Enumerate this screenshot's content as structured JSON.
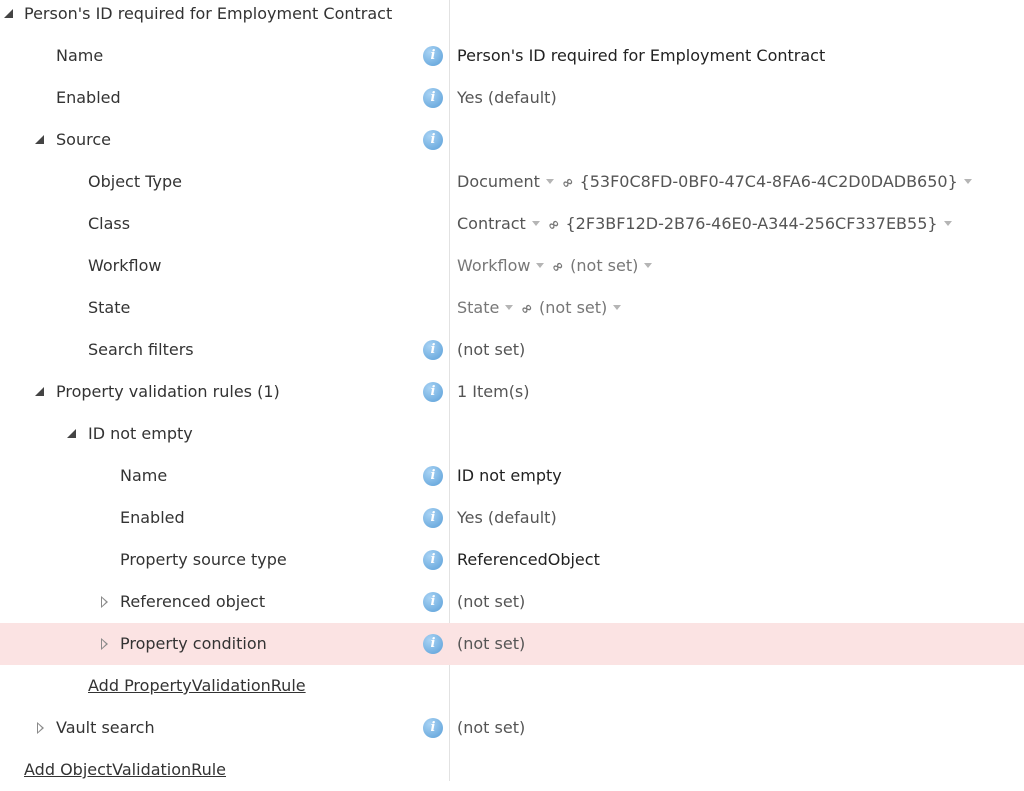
{
  "tree": {
    "root": {
      "label": "Person's ID required for Employment Contract"
    },
    "name": {
      "label": "Name",
      "value": "Person's ID required for Employment Contract"
    },
    "enabled": {
      "label": "Enabled",
      "value": "Yes (default)"
    },
    "source": {
      "label": "Source",
      "object_type": {
        "label": "Object Type",
        "value": "Document",
        "guid": "{53F0C8FD-0BF0-47C4-8FA6-4C2D0DADB650}"
      },
      "class": {
        "label": "Class",
        "value": "Contract",
        "guid": "{2F3BF12D-2B76-46E0-A344-256CF337EB55}"
      },
      "workflow": {
        "label": "Workflow",
        "value": "Workflow",
        "guid": "(not set)"
      },
      "state": {
        "label": "State",
        "value": "State",
        "guid": "(not set)"
      },
      "search_filters": {
        "label": "Search filters",
        "value": "(not set)"
      }
    },
    "pvr": {
      "label": "Property validation rules (1)",
      "value": "1 Item(s)",
      "rule": {
        "label": "ID not empty",
        "name": {
          "label": "Name",
          "value": "ID not empty"
        },
        "enabled": {
          "label": "Enabled",
          "value": "Yes (default)"
        },
        "source_type": {
          "label": "Property source type",
          "value": "ReferencedObject"
        },
        "referenced_object": {
          "label": "Referenced object",
          "value": "(not set)"
        },
        "property_condition": {
          "label": "Property condition",
          "value": "(not set)"
        }
      },
      "add_link": "Add PropertyValidationRule"
    },
    "vault_search": {
      "label": "Vault search",
      "value": "(not set)"
    },
    "add_object_link": "Add ObjectValidationRule"
  },
  "colors": {
    "selected_row": "#fbe3e3",
    "info_icon": "#5a9fd8"
  },
  "icons": {
    "info": "info-icon",
    "expanded": "expanded-triangle-icon",
    "collapsed": "collapsed-triangle-icon",
    "dropdown": "dropdown-arrow-icon",
    "link": "link-icon"
  }
}
